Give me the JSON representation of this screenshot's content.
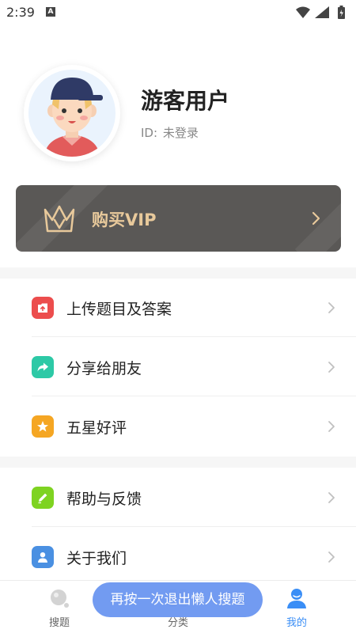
{
  "status_bar": {
    "time": "2:39",
    "badge": "A",
    "icons": [
      "wifi-icon",
      "signal-icon",
      "battery-icon"
    ]
  },
  "profile": {
    "name": "游客用户",
    "id_label": "ID:",
    "id_value": "未登录",
    "avatar": "avatar-cartoon-boy-cap"
  },
  "vip": {
    "label": "购买VIP",
    "icon": "crown-icon",
    "accent_color": "#e8c99b",
    "background_color": "#5a5856"
  },
  "menu_groups": [
    [
      {
        "label": "上传题目及答案",
        "icon": "upload-icon",
        "color": "#ec4d4d"
      },
      {
        "label": "分享给朋友",
        "icon": "share-icon",
        "color": "#2dc9a6"
      },
      {
        "label": "五星好评",
        "icon": "star-icon",
        "color": "#f5a623"
      }
    ],
    [
      {
        "label": "帮助与反馈",
        "icon": "edit-icon",
        "color": "#7ed321"
      },
      {
        "label": "关于我们",
        "icon": "user-icon",
        "color": "#4a90e2"
      }
    ]
  ],
  "bottom_nav": {
    "items": [
      {
        "label": "搜题",
        "icon": "search-icon",
        "active": false
      },
      {
        "label": "分类",
        "icon": "category-icon",
        "active": false
      },
      {
        "label": "我的",
        "icon": "profile-icon",
        "active": true
      }
    ],
    "active_color": "#3a8ef6"
  },
  "toast": {
    "text": "再按一次退出懒人搜题"
  }
}
